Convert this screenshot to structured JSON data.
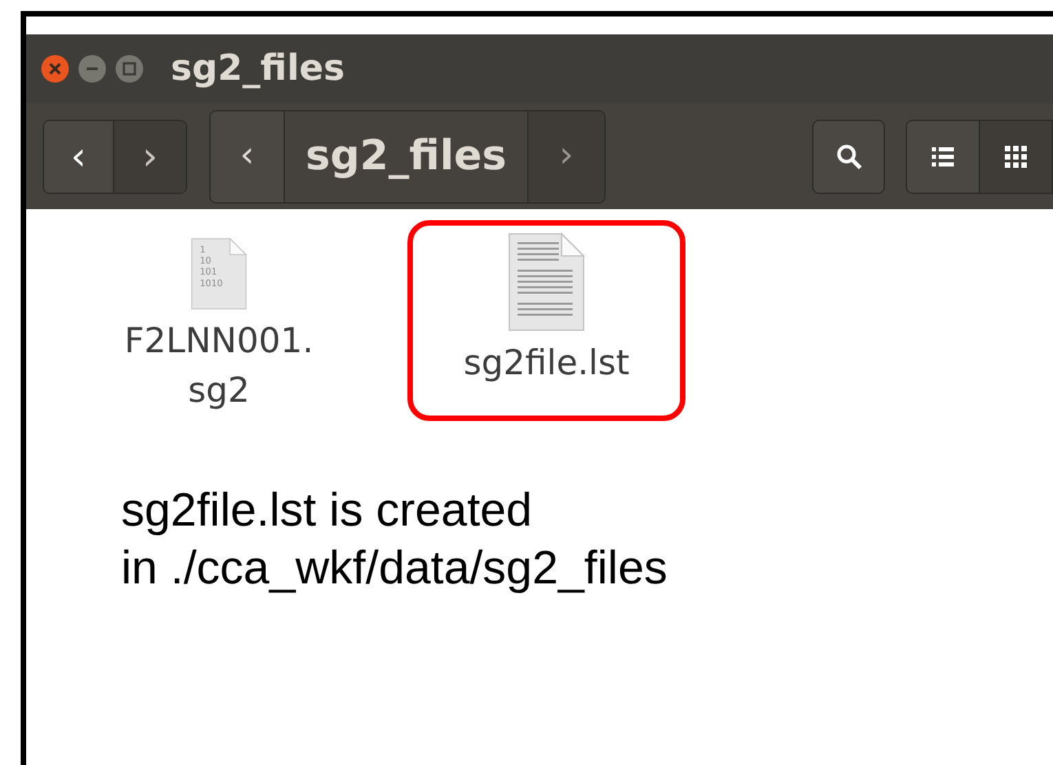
{
  "window": {
    "title": "sg2_files"
  },
  "toolbar": {
    "back": "‹",
    "forward": "›",
    "path_left": "‹",
    "path": "sg2_files",
    "path_right": "›"
  },
  "files": [
    {
      "name": "F2LNN001.\nsg2",
      "kind": "binary",
      "icon_lines": [
        "1",
        "10",
        "101",
        "1010"
      ],
      "highlighted": false
    },
    {
      "name": "sg2file.lst",
      "kind": "text",
      "highlighted": true
    }
  ],
  "caption": [
    "sg2file.lst is created",
    "in ./cca_wkf/data/sg2_files"
  ]
}
